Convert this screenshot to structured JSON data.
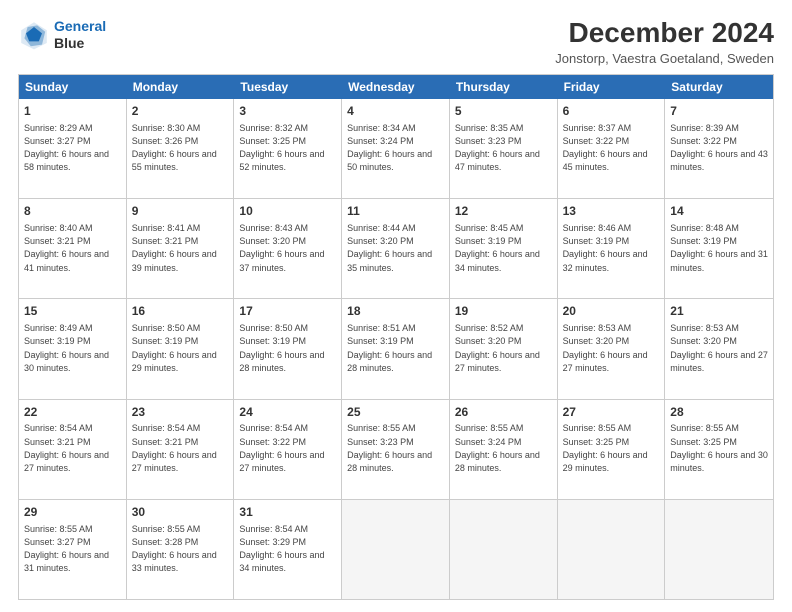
{
  "header": {
    "logo_line1": "General",
    "logo_line2": "Blue",
    "title": "December 2024",
    "subtitle": "Jonstorp, Vaestra Goetaland, Sweden"
  },
  "calendar": {
    "days": [
      "Sunday",
      "Monday",
      "Tuesday",
      "Wednesday",
      "Thursday",
      "Friday",
      "Saturday"
    ],
    "weeks": [
      [
        {
          "day": "1",
          "sunrise": "8:29 AM",
          "sunset": "3:27 PM",
          "daylight": "6 hours and 58 minutes."
        },
        {
          "day": "2",
          "sunrise": "8:30 AM",
          "sunset": "3:26 PM",
          "daylight": "6 hours and 55 minutes."
        },
        {
          "day": "3",
          "sunrise": "8:32 AM",
          "sunset": "3:25 PM",
          "daylight": "6 hours and 52 minutes."
        },
        {
          "day": "4",
          "sunrise": "8:34 AM",
          "sunset": "3:24 PM",
          "daylight": "6 hours and 50 minutes."
        },
        {
          "day": "5",
          "sunrise": "8:35 AM",
          "sunset": "3:23 PM",
          "daylight": "6 hours and 47 minutes."
        },
        {
          "day": "6",
          "sunrise": "8:37 AM",
          "sunset": "3:22 PM",
          "daylight": "6 hours and 45 minutes."
        },
        {
          "day": "7",
          "sunrise": "8:39 AM",
          "sunset": "3:22 PM",
          "daylight": "6 hours and 43 minutes."
        }
      ],
      [
        {
          "day": "8",
          "sunrise": "8:40 AM",
          "sunset": "3:21 PM",
          "daylight": "6 hours and 41 minutes."
        },
        {
          "day": "9",
          "sunrise": "8:41 AM",
          "sunset": "3:21 PM",
          "daylight": "6 hours and 39 minutes."
        },
        {
          "day": "10",
          "sunrise": "8:43 AM",
          "sunset": "3:20 PM",
          "daylight": "6 hours and 37 minutes."
        },
        {
          "day": "11",
          "sunrise": "8:44 AM",
          "sunset": "3:20 PM",
          "daylight": "6 hours and 35 minutes."
        },
        {
          "day": "12",
          "sunrise": "8:45 AM",
          "sunset": "3:19 PM",
          "daylight": "6 hours and 34 minutes."
        },
        {
          "day": "13",
          "sunrise": "8:46 AM",
          "sunset": "3:19 PM",
          "daylight": "6 hours and 32 minutes."
        },
        {
          "day": "14",
          "sunrise": "8:48 AM",
          "sunset": "3:19 PM",
          "daylight": "6 hours and 31 minutes."
        }
      ],
      [
        {
          "day": "15",
          "sunrise": "8:49 AM",
          "sunset": "3:19 PM",
          "daylight": "6 hours and 30 minutes."
        },
        {
          "day": "16",
          "sunrise": "8:50 AM",
          "sunset": "3:19 PM",
          "daylight": "6 hours and 29 minutes."
        },
        {
          "day": "17",
          "sunrise": "8:50 AM",
          "sunset": "3:19 PM",
          "daylight": "6 hours and 28 minutes."
        },
        {
          "day": "18",
          "sunrise": "8:51 AM",
          "sunset": "3:19 PM",
          "daylight": "6 hours and 28 minutes."
        },
        {
          "day": "19",
          "sunrise": "8:52 AM",
          "sunset": "3:20 PM",
          "daylight": "6 hours and 27 minutes."
        },
        {
          "day": "20",
          "sunrise": "8:53 AM",
          "sunset": "3:20 PM",
          "daylight": "6 hours and 27 minutes."
        },
        {
          "day": "21",
          "sunrise": "8:53 AM",
          "sunset": "3:20 PM",
          "daylight": "6 hours and 27 minutes."
        }
      ],
      [
        {
          "day": "22",
          "sunrise": "8:54 AM",
          "sunset": "3:21 PM",
          "daylight": "6 hours and 27 minutes."
        },
        {
          "day": "23",
          "sunrise": "8:54 AM",
          "sunset": "3:21 PM",
          "daylight": "6 hours and 27 minutes."
        },
        {
          "day": "24",
          "sunrise": "8:54 AM",
          "sunset": "3:22 PM",
          "daylight": "6 hours and 27 minutes."
        },
        {
          "day": "25",
          "sunrise": "8:55 AM",
          "sunset": "3:23 PM",
          "daylight": "6 hours and 28 minutes."
        },
        {
          "day": "26",
          "sunrise": "8:55 AM",
          "sunset": "3:24 PM",
          "daylight": "6 hours and 28 minutes."
        },
        {
          "day": "27",
          "sunrise": "8:55 AM",
          "sunset": "3:25 PM",
          "daylight": "6 hours and 29 minutes."
        },
        {
          "day": "28",
          "sunrise": "8:55 AM",
          "sunset": "3:25 PM",
          "daylight": "6 hours and 30 minutes."
        }
      ],
      [
        {
          "day": "29",
          "sunrise": "8:55 AM",
          "sunset": "3:27 PM",
          "daylight": "6 hours and 31 minutes."
        },
        {
          "day": "30",
          "sunrise": "8:55 AM",
          "sunset": "3:28 PM",
          "daylight": "6 hours and 33 minutes."
        },
        {
          "day": "31",
          "sunrise": "8:54 AM",
          "sunset": "3:29 PM",
          "daylight": "6 hours and 34 minutes."
        },
        {
          "day": "",
          "sunrise": "",
          "sunset": "",
          "daylight": ""
        },
        {
          "day": "",
          "sunrise": "",
          "sunset": "",
          "daylight": ""
        },
        {
          "day": "",
          "sunrise": "",
          "sunset": "",
          "daylight": ""
        },
        {
          "day": "",
          "sunrise": "",
          "sunset": "",
          "daylight": ""
        }
      ]
    ]
  }
}
